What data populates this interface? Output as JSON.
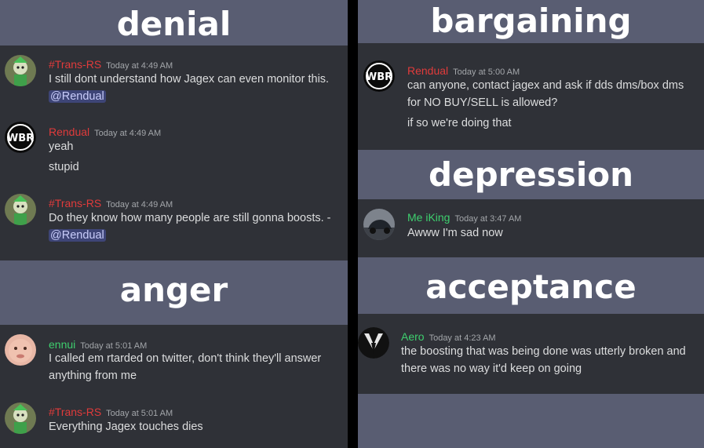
{
  "colors": {
    "header_bg": "#595d72",
    "panel_bg": "#2f3137",
    "divider": "#000000",
    "name_red": "#e03b3b",
    "name_green": "#3ecf6e",
    "mention_bg": "#3e4577",
    "text": "#dcddde"
  },
  "left": {
    "sections": [
      {
        "title": "denial",
        "messages": [
          {
            "author": "#Trans-RS",
            "name_color": "#e03b3b",
            "avatar": "green-character-avatar-icon",
            "time": "Today at 4:49 AM",
            "lines": [
              "I still dont understand how Jagex can even monitor this."
            ],
            "mention": "@Rendual"
          },
          {
            "author": "Rendual",
            "name_color": "#e03b3b",
            "avatar": "wbr-logo-avatar-icon",
            "time": "Today at 4:49 AM",
            "lines": [
              "yeah",
              "stupid"
            ]
          },
          {
            "author": "#Trans-RS",
            "name_color": "#e03b3b",
            "avatar": "green-character-avatar-icon",
            "time": "Today at 4:49 AM",
            "lines": [
              "Do they know how many people are still gonna boosts. -"
            ],
            "mention": "@Rendual"
          }
        ]
      },
      {
        "title": "anger",
        "messages": [
          {
            "author": "ennui",
            "name_color": "#3ecf6e",
            "avatar": "face-avatar-icon",
            "time": "Today at 5:01 AM",
            "lines": [
              "I called em rtarded on twitter, don't think they'll answer",
              "anything from me"
            ]
          },
          {
            "author": "#Trans-RS",
            "name_color": "#e03b3b",
            "avatar": "green-character-avatar-icon",
            "time": "Today at 5:01 AM",
            "lines": [
              "Everything Jagex touches dies"
            ]
          }
        ]
      }
    ]
  },
  "right": {
    "sections": [
      {
        "title": "bargaining",
        "messages": [
          {
            "author": "Rendual",
            "name_color": "#e03b3b",
            "avatar": "wbr-logo-avatar-icon",
            "time": "Today at 5:00 AM",
            "lines": [
              "can anyone, contact jagex and ask if dds dms/box dms",
              "for NO BUY/SELL is allowed?",
              "if so we're doing that"
            ]
          }
        ]
      },
      {
        "title": "depression",
        "messages": [
          {
            "author": "Me iKing",
            "name_color": "#3ecf6e",
            "avatar": "car-photo-avatar-icon",
            "time": "Today at 3:47 AM",
            "lines": [
              "Awww I'm sad now"
            ]
          }
        ]
      },
      {
        "title": "acceptance",
        "messages": [
          {
            "author": "Aero",
            "name_color": "#3ecf6e",
            "avatar": "suit-avatar-icon",
            "time": "Today at 4:23 AM",
            "lines": [
              "the boosting that was being done was utterly broken and",
              "there was no way it'd keep on going"
            ]
          }
        ]
      }
    ]
  }
}
